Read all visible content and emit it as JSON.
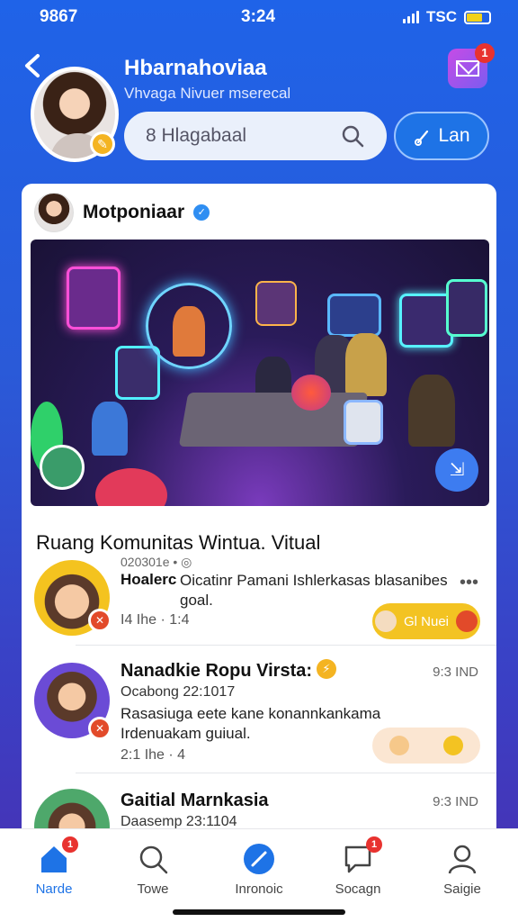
{
  "status_bar": {
    "carrier": "9867",
    "time": "3:24",
    "network": "TSC"
  },
  "header": {
    "title": "Hbarnahoviaa",
    "subtitle": "Vhvaga Nivuer mserecal",
    "mail_badge": "1"
  },
  "search": {
    "value": "8 Hlagabaal"
  },
  "lan_button": {
    "label": "Lan"
  },
  "post": {
    "author": "Motponiaar",
    "section_title": "Ruang Komunitas Wintua. Vitual"
  },
  "chats": [
    {
      "meta": "020301e • ◎",
      "name": "Hoalerc",
      "message": "Oicatinr Pamani Ishlerkasas blasanibes goal.",
      "sub": "I4 Ihe · 1:4",
      "pill_label": "Gl Nuei",
      "accent": "#f3c322"
    },
    {
      "name": "Nanadkie Ropu Virsta:",
      "time": "9:3 IND",
      "meta": "Ocabong 22:1017",
      "message": "Rasasiuga eete kane konannkankama Irdenuakam guiual.",
      "sub": "2:1 Ihe · 4"
    },
    {
      "name": "Gaitial Marnkasia",
      "time": "9:3 IND",
      "meta": "Daasemp 23:1104"
    }
  ],
  "nav": {
    "items": [
      "Narde",
      "Towe",
      "Inronoic",
      "Socagn",
      "Saigie"
    ],
    "home_badge": "1",
    "social_badge": "1",
    "active_color": "#1e73e6"
  }
}
